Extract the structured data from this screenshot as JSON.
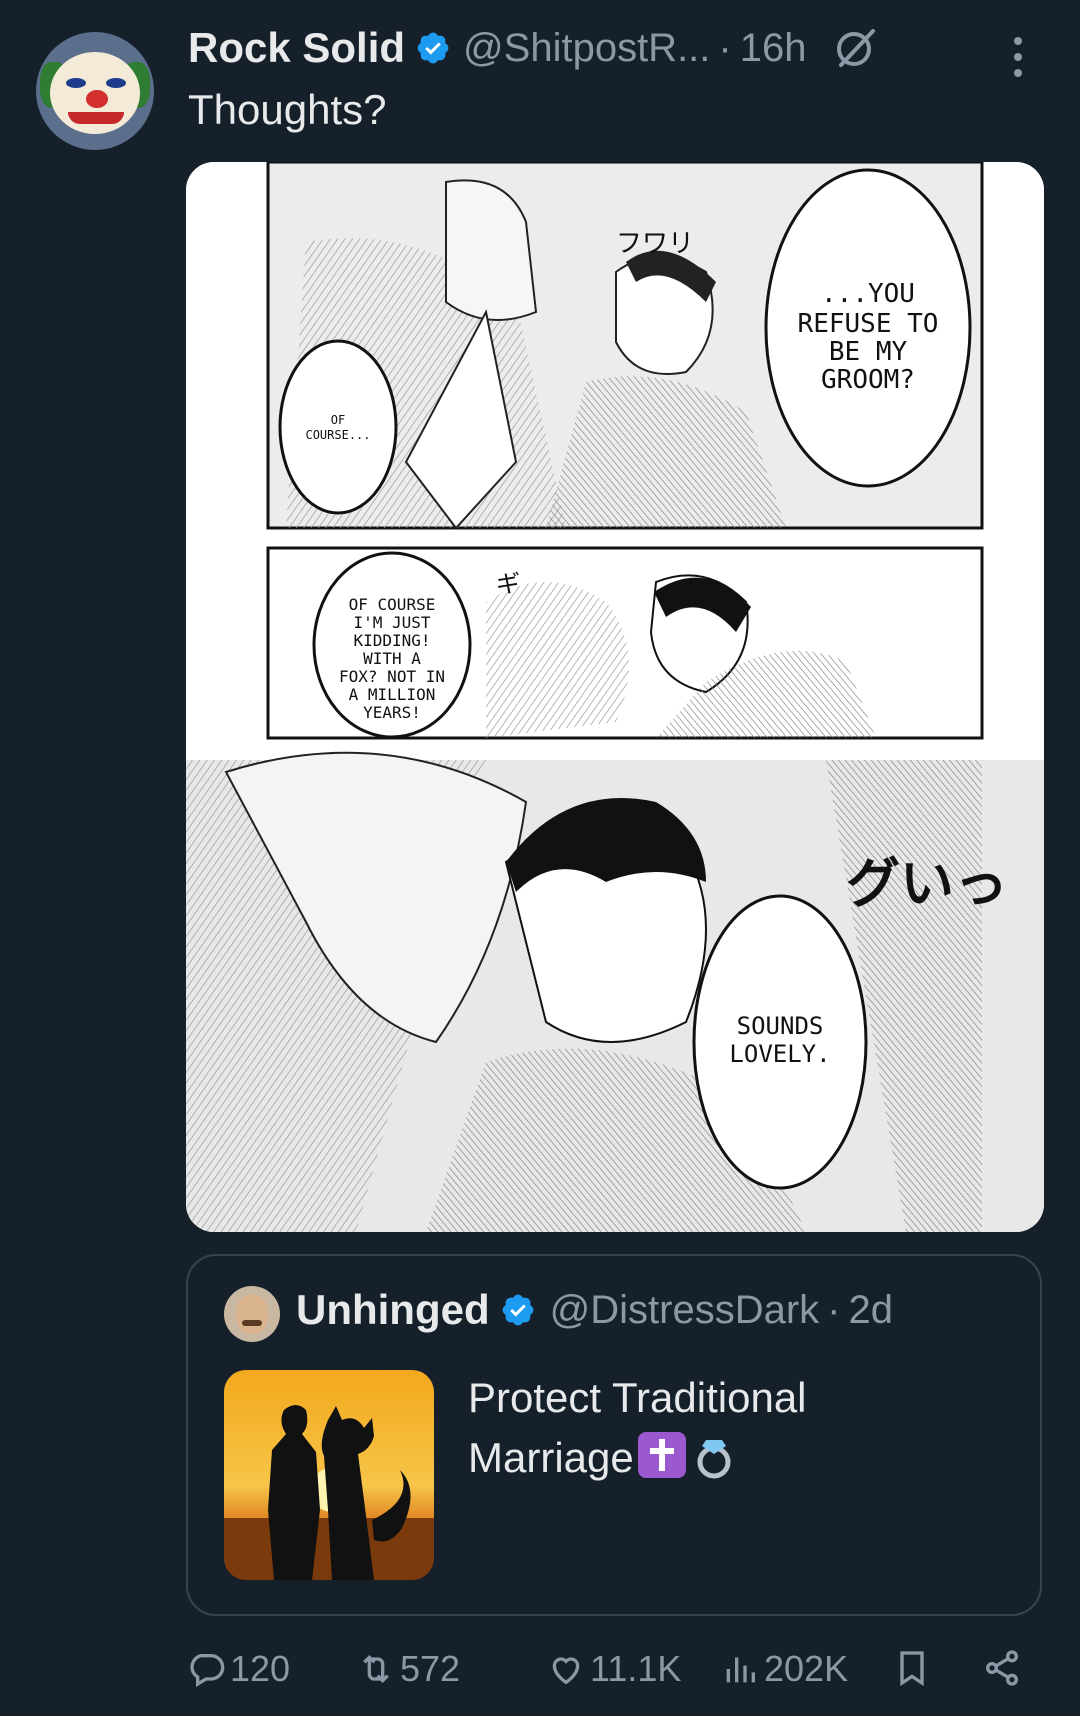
{
  "tweet": {
    "author": {
      "name": "Rock Solid",
      "handle": "@ShitpostR...",
      "separator": "·",
      "time": "16h",
      "verified_color": "#1d9bf0"
    },
    "text": "Thoughts?",
    "media": {
      "panels": [
        {
          "bubbles": [
            "...YOU REFUSE TO BE MY GROOM?",
            "OF COURSE..."
          ],
          "sfx": "フワリ"
        },
        {
          "bubbles": [
            "OF COURSE I'M JUST KIDDING! WITH A FOX? NOT IN A MILLION YEARS!"
          ],
          "sfx": "ギ"
        },
        {
          "bubbles": [
            "SOUNDS LOVELY."
          ],
          "sfx": "グいっ"
        }
      ]
    },
    "quoted": {
      "name": "Unhinged",
      "handle": "@DistressDark",
      "separator": "·",
      "time": "2d",
      "text_line1": "Protect Traditional",
      "text_line2": "Marriage"
    },
    "actions": {
      "replies": "120",
      "retweets": "572",
      "likes": "11.1K",
      "views": "202K"
    },
    "icons": [
      "grok-icon",
      "more-icon",
      "reply-icon",
      "retweet-icon",
      "like-icon",
      "views-icon",
      "bookmark-icon",
      "share-icon",
      "verified-icon",
      "cross-emoji",
      "ring-emoji"
    ]
  }
}
